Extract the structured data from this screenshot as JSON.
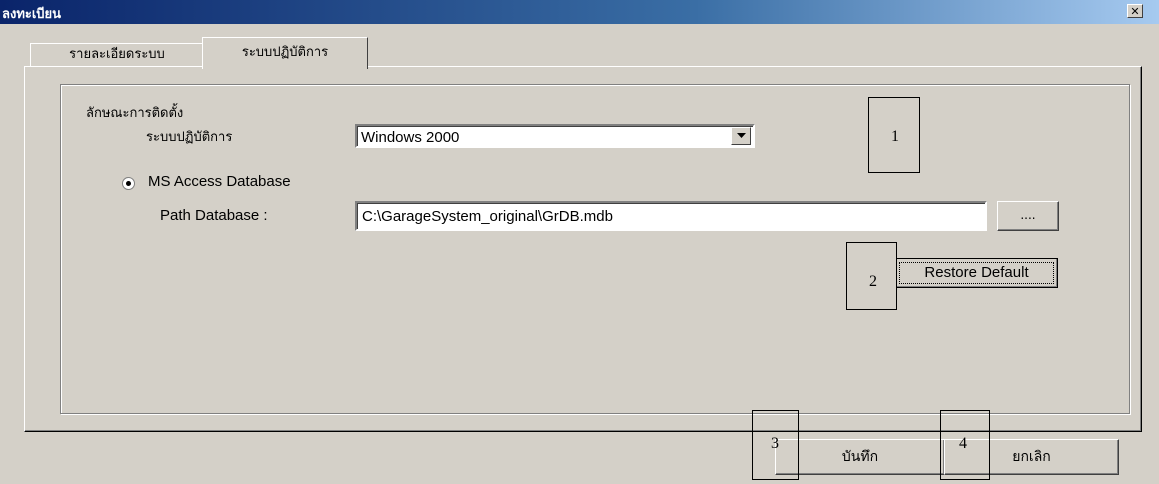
{
  "window": {
    "title": "ลงทะเบียน",
    "close_glyph": "✕"
  },
  "tabs": [
    {
      "label": "รายละเอียดระบบ",
      "active": false
    },
    {
      "label": "ระบบปฏิบัติการ",
      "active": true
    }
  ],
  "install_group": {
    "title": "ลักษณะการติดตั้ง",
    "os_label": "ระบบปฏิบัติการ",
    "os_select_value": "Windows 2000",
    "dropdown_icon": "chevron-down-icon",
    "db_option_label": "MS Access Database",
    "db_option_selected": true,
    "path_label": "Path Database :",
    "path_value": "C:\\GarageSystem_original\\GrDB.mdb",
    "browse_label": "....",
    "restore_label": "Restore Default"
  },
  "footer": {
    "save_label": "บันทึก",
    "cancel_label": "ยกเลิก"
  },
  "markers": [
    "1",
    "2",
    "3",
    "4"
  ]
}
